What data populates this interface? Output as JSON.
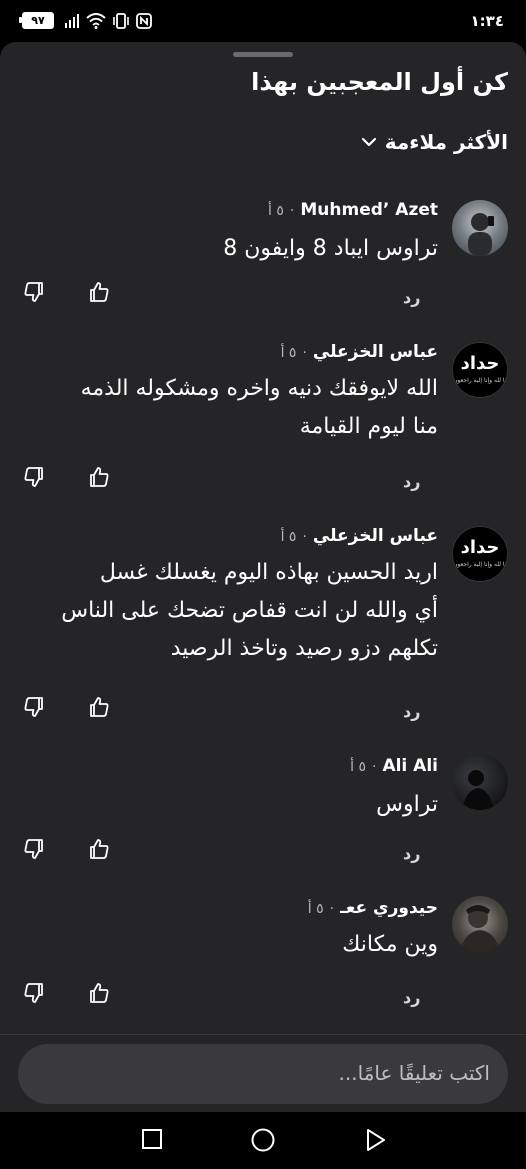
{
  "status_bar": {
    "time": "١:٣٤",
    "battery": "٩٧",
    "signal_label": "4G"
  },
  "sheet": {
    "first_to_like": "كن أول المعجبين بهذا",
    "sort_label": "الأكثر ملاءمة"
  },
  "comments": [
    {
      "author": "Muhmed’ Azet",
      "time": "٥ أ",
      "text": [
        "تراوس ايباد 8 وايفون 8"
      ],
      "reply": "رد",
      "avatar_icon": "avatar-photo"
    },
    {
      "author": "عباس الخزعلي",
      "time": "٥ أ",
      "text": [
        "الله لايوفقك دنيه واخره ومشكوله الذمه",
        "منا ليوم القيامة"
      ],
      "reply": "رد",
      "avatar_icon": "avatar-text",
      "avatar_text": "حداد",
      "avatar_subtext": "إنا لله وإنا إليه راجعون"
    },
    {
      "author": "عباس الخزعلي",
      "time": "٥ أ",
      "text": [
        "اريد الحسين بهاذه اليوم يغسلك غسل",
        "أي والله لن انت قفاص تضحك على الناس",
        "تكلهم دزو رصيد وتاخذ الرصيد"
      ],
      "reply": "رد",
      "avatar_icon": "avatar-text",
      "avatar_text": "حداد",
      "avatar_subtext": "إنا لله وإنا إليه راجعون"
    },
    {
      "author": "Ali Ali",
      "time": "٥ أ",
      "text": [
        "تراوس"
      ],
      "reply": "رد",
      "avatar_icon": "avatar-photo"
    },
    {
      "author": "حيدوري ععـ",
      "time": "٥ أ",
      "text": [
        "وين مكانك"
      ],
      "reply": "رد",
      "avatar_icon": "avatar-photo"
    }
  ],
  "composer": {
    "placeholder": "اكتب تعليقًا عامًا..."
  },
  "colors": {
    "sheet_bg": "#252527",
    "input_bg": "#3a3a3d",
    "text": "#ffffff",
    "muted": "#b8b8bb"
  }
}
